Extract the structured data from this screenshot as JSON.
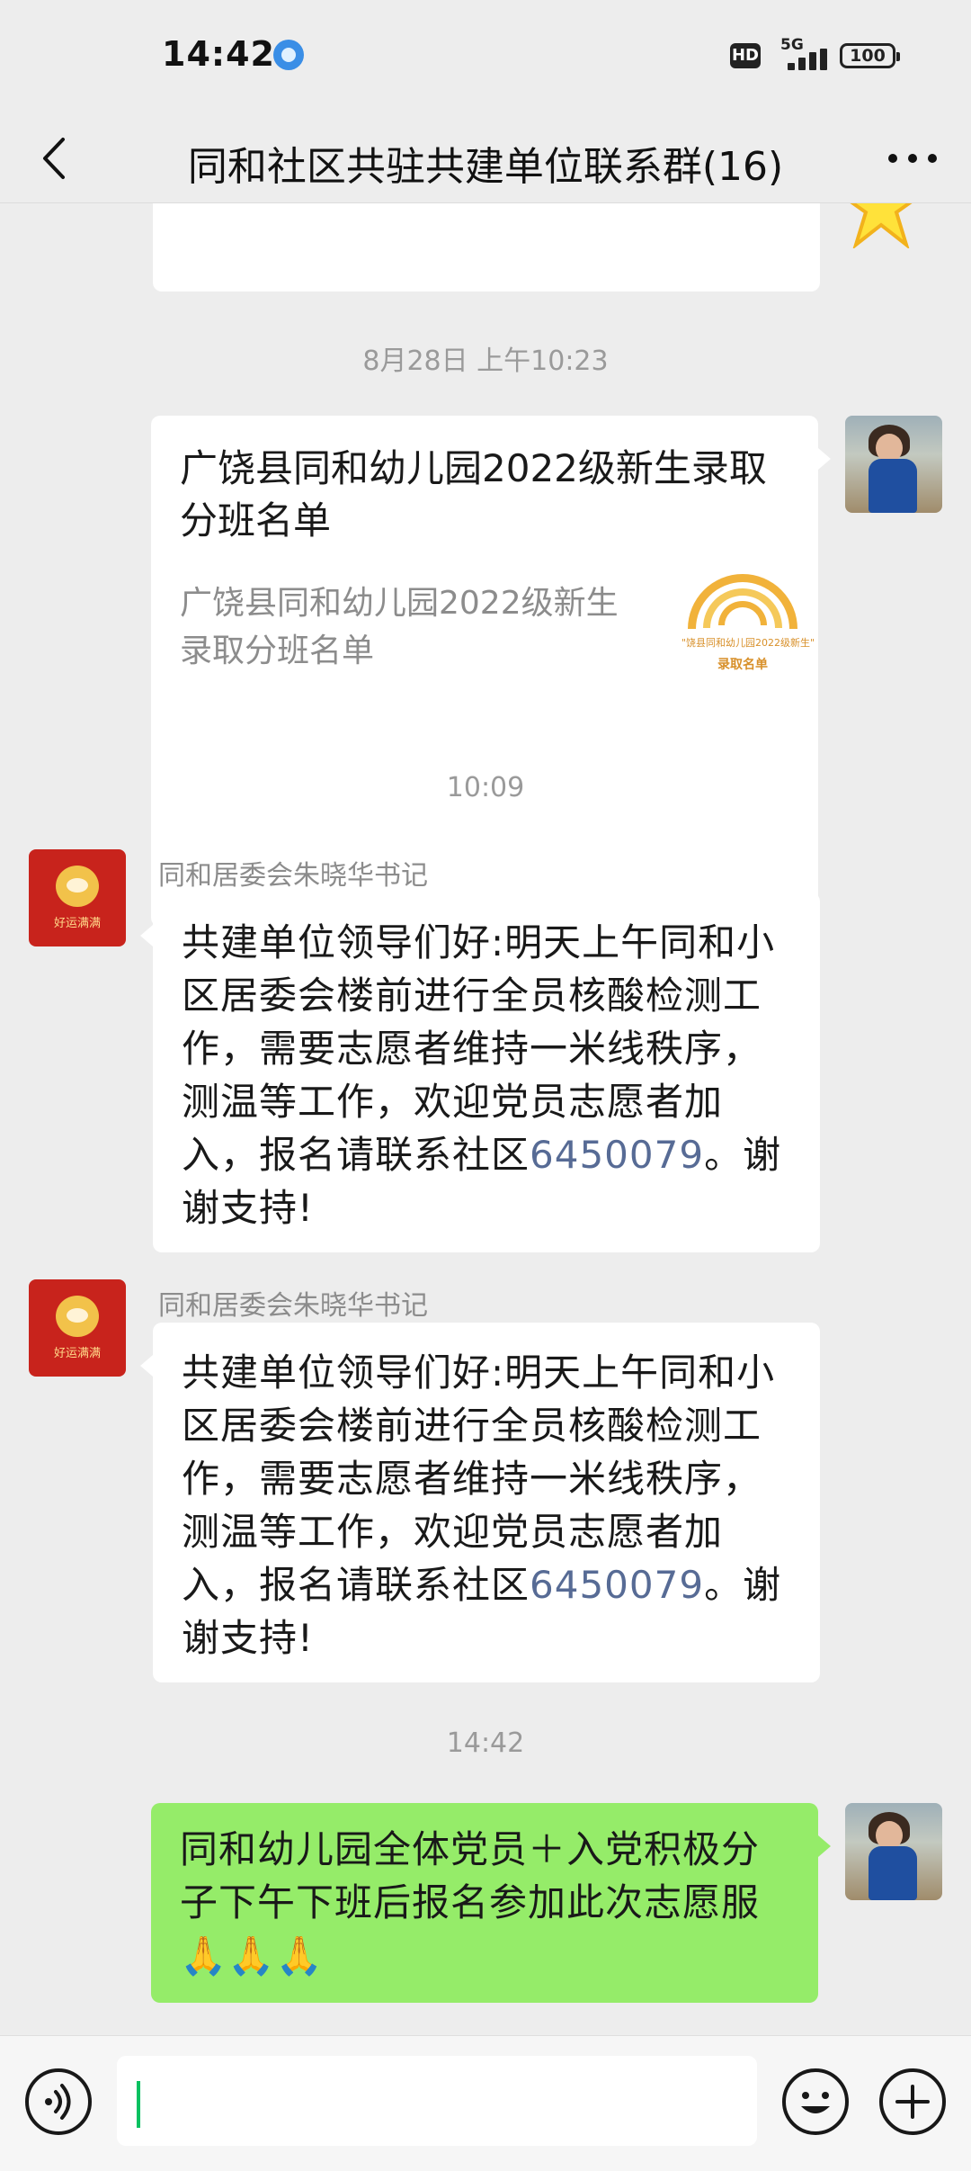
{
  "status_bar": {
    "time": "14:42",
    "network_badge": "HD",
    "network_type": "5G",
    "battery": "100"
  },
  "header": {
    "title": "同和社区共驻共建单位联系群(16)"
  },
  "messages": {
    "ts1": "8月28日 上午10:23",
    "card": {
      "title": "广饶县同和幼儿园2022级新生录取分班名单",
      "desc": "广饶县同和幼儿园2022级新生录取分班名单",
      "thumb_line1": "\"饶县同和幼儿园2022级新生\"",
      "thumb_line2": "录取名单"
    },
    "ts2": "10:09",
    "msg1": {
      "sender": "同和居委会朱晓华书记",
      "text_before": "共建单位领导们好:明天上午同和小区居委会楼前进行全员核酸检测工作，需要志愿者维持一米线秩序，测温等工作，欢迎党员志愿者加入，报名请联系社区",
      "phone": "6450079",
      "text_after": "。谢谢支持!",
      "avatar_caption": "好运满满"
    },
    "msg2": {
      "sender": "同和居委会朱晓华书记",
      "text_before": "共建单位领导们好:明天上午同和小区居委会楼前进行全员核酸检测工作，需要志愿者维持一米线秩序，测温等工作，欢迎党员志愿者加入，报名请联系社区",
      "phone": "6450079",
      "text_after": "。谢谢支持!",
      "avatar_caption": "好运满满"
    },
    "ts3": "14:42",
    "msg3": {
      "text": "同和幼儿园全体党员＋入党积极分子下午下班后报名参加此次志愿服",
      "emoji": "🙏🙏🙏"
    }
  },
  "colors": {
    "background": "#ededed",
    "bubble_self": "#95ec69",
    "link": "#576b95",
    "cursor": "#07c160"
  },
  "icons": [
    "back-arrow-icon",
    "more-icon",
    "voice-icon",
    "emoji-icon",
    "plus-icon",
    "star-icon"
  ]
}
